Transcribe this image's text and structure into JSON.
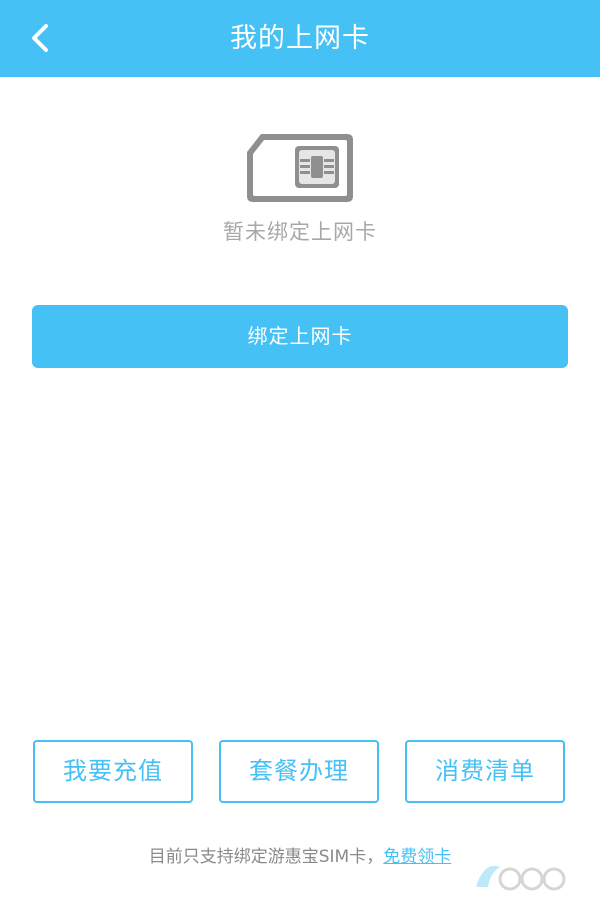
{
  "header": {
    "title": "我的上网卡",
    "back_icon": "chevron-left-icon",
    "background": "#45c1f6"
  },
  "empty_state": {
    "icon": "sim-card-icon",
    "message": "暂未绑定上网卡"
  },
  "bind_button": {
    "label": "绑定上网卡"
  },
  "actions": [
    {
      "label": "我要充值"
    },
    {
      "label": "套餐办理"
    },
    {
      "label": "消费清单"
    }
  ],
  "footer": {
    "note": "目前只支持绑定游惠宝SIM卡，",
    "link": "免费领卡"
  },
  "colors": {
    "accent": "#45c1f6",
    "text_muted": "#a8a8a8"
  }
}
